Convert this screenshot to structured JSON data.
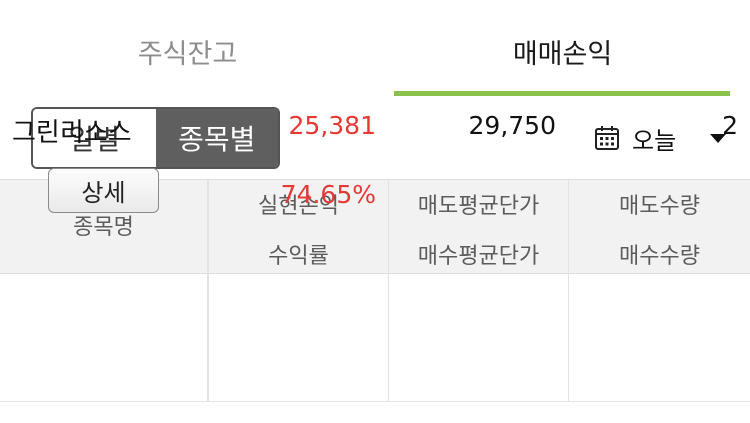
{
  "tabs": [
    {
      "label": "주식잔고"
    },
    {
      "label": "매매손익"
    }
  ],
  "segmented": {
    "options": [
      {
        "label": "일별"
      },
      {
        "label": "종목별"
      }
    ]
  },
  "date_select": {
    "label": "오늘",
    "icon": "calendar-icon"
  },
  "colors": {
    "accent_green": "#8bc34a",
    "profit_red": "#e53935",
    "selected_segment": "#5f5f5f"
  },
  "table": {
    "headers": {
      "name": "종목명",
      "realized_pnl": "실현손익",
      "return_rate": "수익률",
      "avg_sell_price": "매도평균단가",
      "avg_buy_price": "매수평균단가",
      "sell_qty": "매도수량",
      "buy_qty": "매수수량"
    },
    "rows": [
      {
        "name": "그린리소스",
        "detail_label": "상세",
        "realized_pnl": "25,381",
        "return_rate": "74.65%",
        "avg_sell_price": "29,750",
        "avg_buy_price": "",
        "sell_qty": "2",
        "buy_qty": ""
      }
    ]
  }
}
